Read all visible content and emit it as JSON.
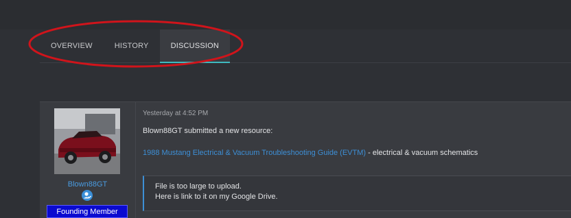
{
  "tabs": [
    {
      "label": "OVERVIEW"
    },
    {
      "label": "HISTORY"
    },
    {
      "label": "DISCUSSION"
    }
  ],
  "active_tab": "DISCUSSION",
  "post": {
    "username": "Blown88GT",
    "user_title": "Founding Member",
    "timestamp": "Yesterday at 4:52 PM",
    "intro": "Blown88GT submitted a new resource:",
    "resource_link": "1988 Mustang Electrical & Vacuum Troubleshooting Guide (EVTM)",
    "resource_suffix": " - electrical & vacuum schematics",
    "quote_line1": "File is too large to upload.",
    "quote_line2": "Here is link to it on my Google Drive."
  },
  "colors": {
    "background": "#2e3035",
    "link": "#3d8fd6",
    "tab_accent": "#3fb9bf",
    "annotation": "#d0141b",
    "user_title_bg": "#0a0ad0"
  },
  "icons": {
    "user_badge": "user-check-icon"
  }
}
